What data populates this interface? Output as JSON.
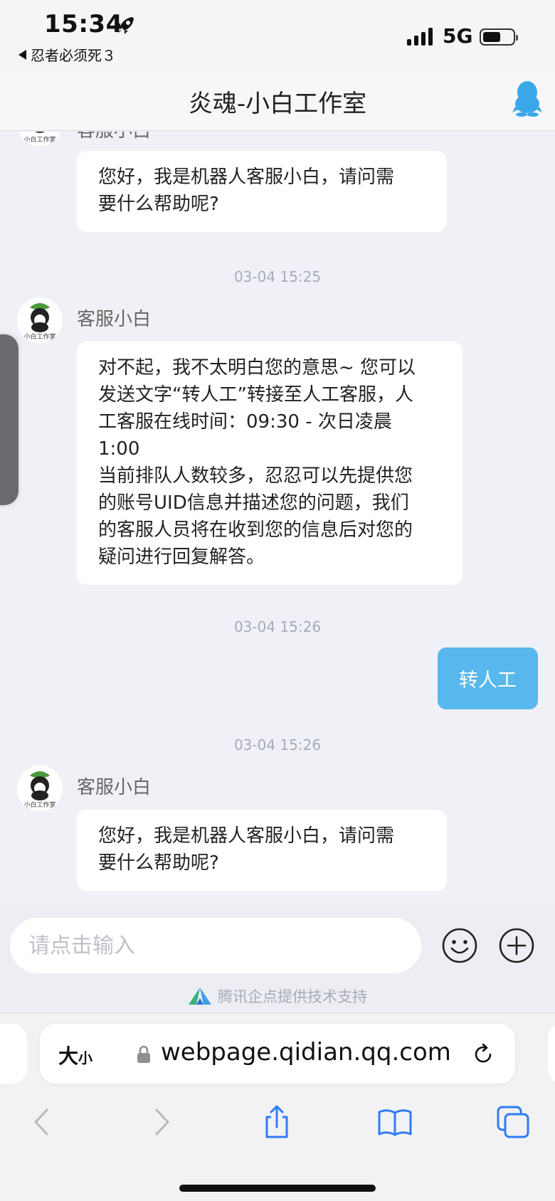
{
  "status_bar": {
    "time": "15:34",
    "back_app": "忍者必须死３",
    "network": "5G"
  },
  "header": {
    "title": "炎魂-小白工作室"
  },
  "chat": {
    "partial_sender": "客服小白",
    "messages": [
      {
        "type": "bot",
        "text": "您好，我是机器人客服小白，请问需\n要什么帮助呢?"
      },
      {
        "type": "time",
        "text": "03-04 15:25"
      },
      {
        "type": "bot",
        "sender": "客服小白",
        "text": "对不起，我不太明白您的意思~ 您可以\n发送文字“转人工”转接至人工客服，人\n工客服在线时间：09:30 - 次日凌晨\n1:00\n当前排队人数较多，忍忍可以先提供您\n的账号UID信息并描述您的问题，我们\n的客服人员将在收到您的信息后对您的\n疑问进行回复解答。"
      },
      {
        "type": "time",
        "text": "03-04 15:26"
      },
      {
        "type": "user",
        "text": "转人工"
      },
      {
        "type": "time",
        "text": "03-04 15:26"
      },
      {
        "type": "bot",
        "sender": "客服小白",
        "text": "您好，我是机器人客服小白，请问需\n要什么帮助呢?"
      }
    ],
    "avatar_caption": "小白工作室"
  },
  "input": {
    "placeholder": "请点击输入",
    "powered_by": "腾讯企点提供技术支持"
  },
  "browser": {
    "text_size_label": "大小",
    "text_size_big": "大",
    "text_size_small": "小",
    "url": "webpage.qidian.qq.com"
  },
  "colors": {
    "accent_blue": "#58b7ec",
    "background": "#f0f1f6"
  }
}
